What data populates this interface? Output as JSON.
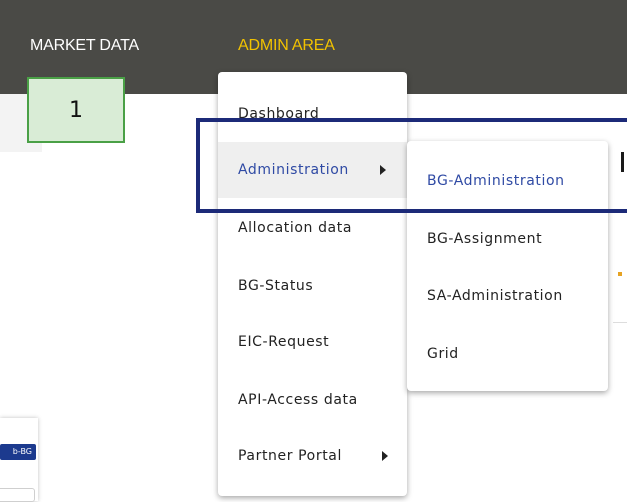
{
  "nav": {
    "market_data": "MARKET DATA",
    "admin_area": "ADMIN AREA"
  },
  "step_badge": "1",
  "menu": {
    "items": [
      {
        "label": "Dashboard"
      },
      {
        "label": "Administration"
      },
      {
        "label": "Allocation data"
      },
      {
        "label": "BG-Status"
      },
      {
        "label": "EIC-Request"
      },
      {
        "label": "API-Access data"
      },
      {
        "label": "Partner Portal"
      }
    ]
  },
  "submenu": {
    "items": [
      {
        "label": "BG-Administration"
      },
      {
        "label": "BG-Assignment"
      },
      {
        "label": "SA-Administration"
      },
      {
        "label": "Grid"
      }
    ]
  },
  "background": {
    "chip_label": "b-BG"
  },
  "colors": {
    "topbar": "#4a4a46",
    "admin_accent": "#f2c200",
    "active_link": "#2f4aa4",
    "highlight_border": "#1c2a78",
    "badge_fill": "#d9ecd6",
    "badge_border": "#4aa046"
  },
  "icons": {
    "submenu_arrow": "caret-right-icon"
  }
}
